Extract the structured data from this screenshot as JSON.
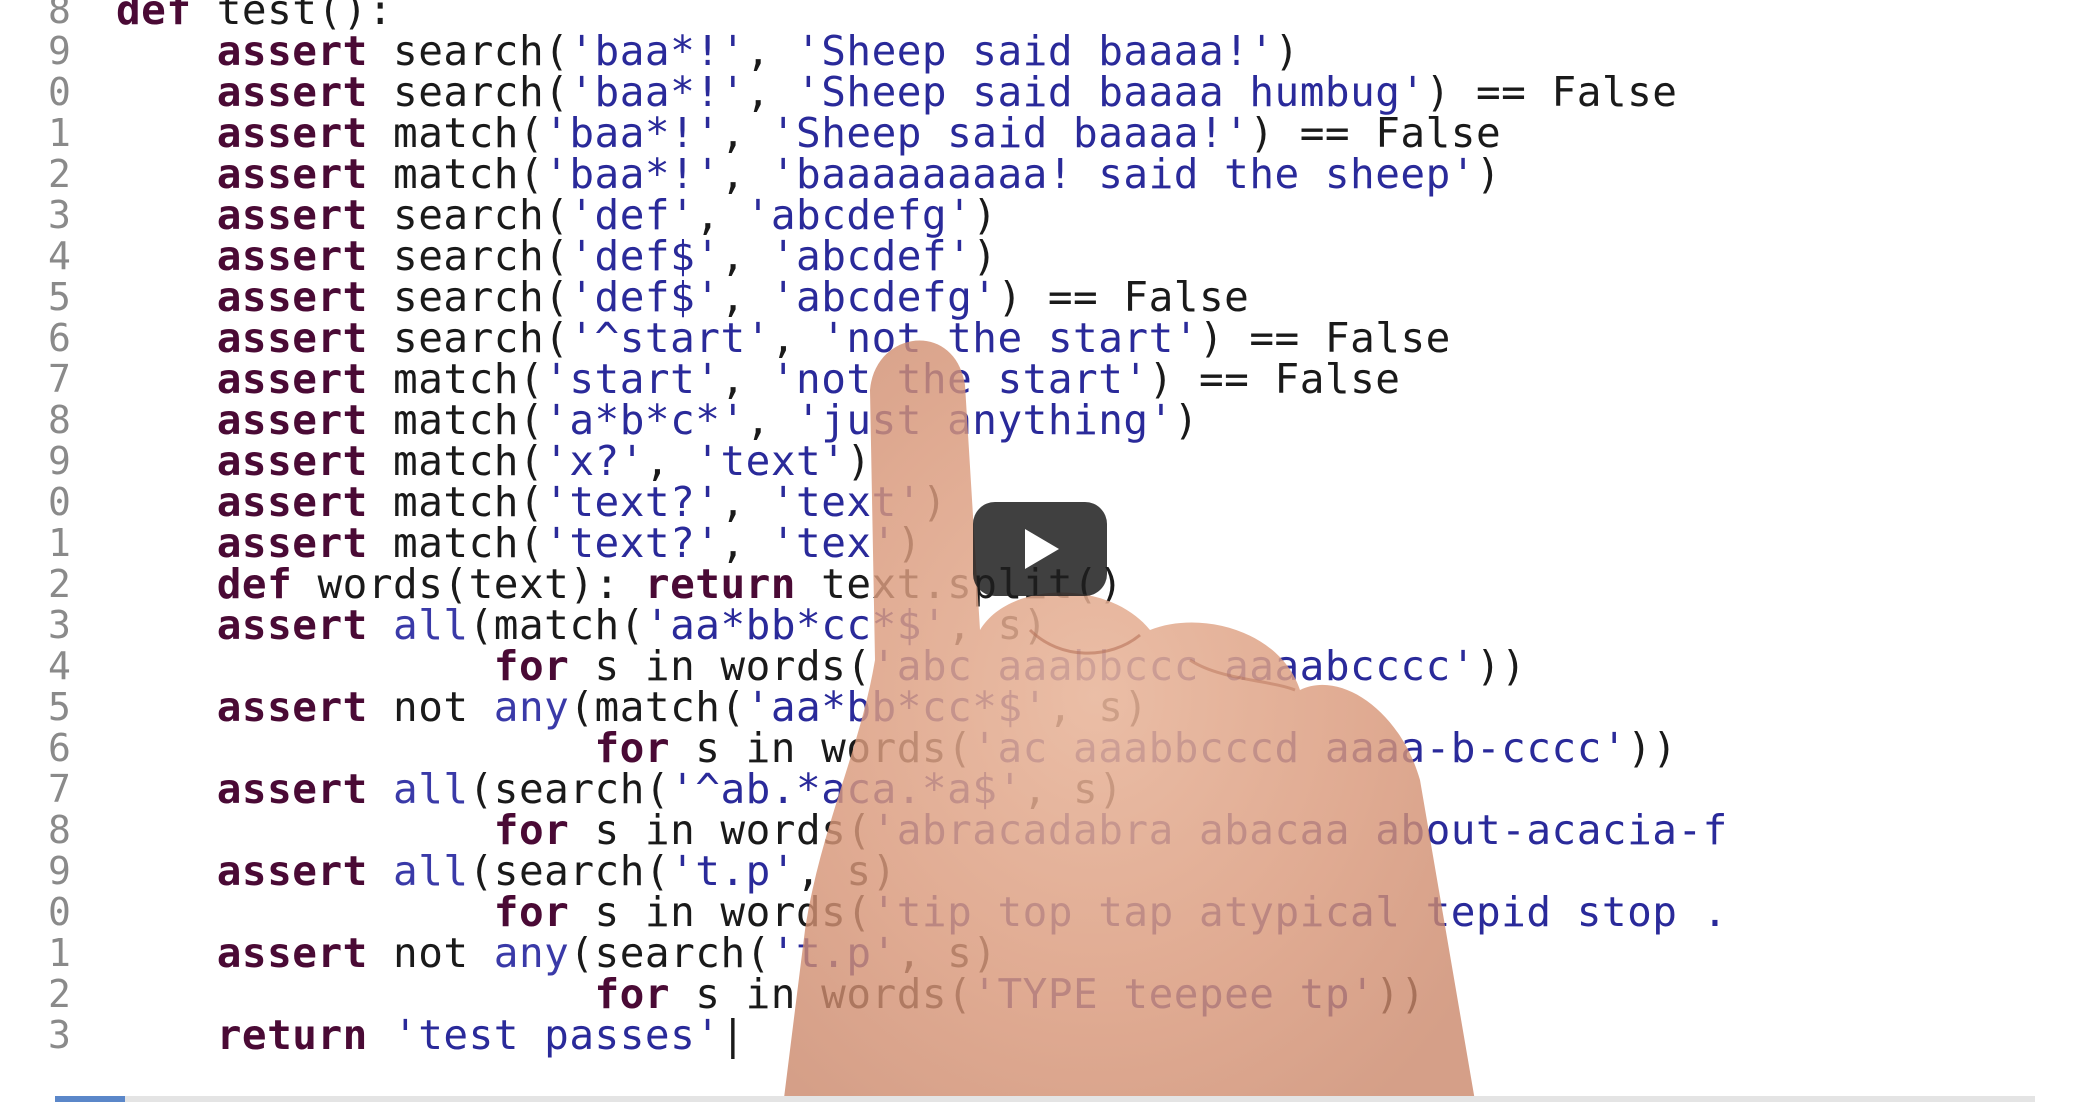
{
  "gutter_numbers": [
    "8",
    "9",
    "0",
    "1",
    "2",
    "3",
    "4",
    "5",
    "6",
    "7",
    "8",
    "9",
    "0",
    "1",
    "2",
    "3",
    "4",
    "5",
    "6",
    "7",
    "8",
    "9",
    "0",
    "1",
    "2",
    "3"
  ],
  "code_lines": [
    [
      {
        "t": "def",
        "c": "kw"
      },
      {
        "t": " test():",
        "c": "fn"
      }
    ],
    [
      {
        "t": "    ",
        "c": "fn"
      },
      {
        "t": "assert",
        "c": "kw"
      },
      {
        "t": " search(",
        "c": "fn"
      },
      {
        "t": "'baa*!'",
        "c": "str"
      },
      {
        "t": ", ",
        "c": "fn"
      },
      {
        "t": "'Sheep said baaaa!'",
        "c": "str"
      },
      {
        "t": ")",
        "c": "fn"
      }
    ],
    [
      {
        "t": "    ",
        "c": "fn"
      },
      {
        "t": "assert",
        "c": "kw"
      },
      {
        "t": " search(",
        "c": "fn"
      },
      {
        "t": "'baa*!'",
        "c": "str"
      },
      {
        "t": ", ",
        "c": "fn"
      },
      {
        "t": "'Sheep said baaaa humbug'",
        "c": "str"
      },
      {
        "t": ") == False",
        "c": "fn"
      }
    ],
    [
      {
        "t": "    ",
        "c": "fn"
      },
      {
        "t": "assert",
        "c": "kw"
      },
      {
        "t": " match(",
        "c": "fn"
      },
      {
        "t": "'baa*!'",
        "c": "str"
      },
      {
        "t": ", ",
        "c": "fn"
      },
      {
        "t": "'Sheep said baaaa!'",
        "c": "str"
      },
      {
        "t": ") == False",
        "c": "fn"
      }
    ],
    [
      {
        "t": "    ",
        "c": "fn"
      },
      {
        "t": "assert",
        "c": "kw"
      },
      {
        "t": " match(",
        "c": "fn"
      },
      {
        "t": "'baa*!'",
        "c": "str"
      },
      {
        "t": ", ",
        "c": "fn"
      },
      {
        "t": "'baaaaaaaaa! said the sheep'",
        "c": "str"
      },
      {
        "t": ")",
        "c": "fn"
      }
    ],
    [
      {
        "t": "    ",
        "c": "fn"
      },
      {
        "t": "assert",
        "c": "kw"
      },
      {
        "t": " search(",
        "c": "fn"
      },
      {
        "t": "'def'",
        "c": "str"
      },
      {
        "t": ", ",
        "c": "fn"
      },
      {
        "t": "'abcdefg'",
        "c": "str"
      },
      {
        "t": ")",
        "c": "fn"
      }
    ],
    [
      {
        "t": "    ",
        "c": "fn"
      },
      {
        "t": "assert",
        "c": "kw"
      },
      {
        "t": " search(",
        "c": "fn"
      },
      {
        "t": "'def$'",
        "c": "str"
      },
      {
        "t": ", ",
        "c": "fn"
      },
      {
        "t": "'abcdef'",
        "c": "str"
      },
      {
        "t": ")",
        "c": "fn"
      }
    ],
    [
      {
        "t": "    ",
        "c": "fn"
      },
      {
        "t": "assert",
        "c": "kw"
      },
      {
        "t": " search(",
        "c": "fn"
      },
      {
        "t": "'def$'",
        "c": "str"
      },
      {
        "t": ", ",
        "c": "fn"
      },
      {
        "t": "'abcdefg'",
        "c": "str"
      },
      {
        "t": ") == False",
        "c": "fn"
      }
    ],
    [
      {
        "t": "    ",
        "c": "fn"
      },
      {
        "t": "assert",
        "c": "kw"
      },
      {
        "t": " search(",
        "c": "fn"
      },
      {
        "t": "'^start'",
        "c": "str"
      },
      {
        "t": ", ",
        "c": "fn"
      },
      {
        "t": "'not the start'",
        "c": "str"
      },
      {
        "t": ") == False",
        "c": "fn"
      }
    ],
    [
      {
        "t": "    ",
        "c": "fn"
      },
      {
        "t": "assert",
        "c": "kw"
      },
      {
        "t": " match(",
        "c": "fn"
      },
      {
        "t": "'start'",
        "c": "str"
      },
      {
        "t": ", ",
        "c": "fn"
      },
      {
        "t": "'not the start'",
        "c": "str"
      },
      {
        "t": ") == False",
        "c": "fn"
      }
    ],
    [
      {
        "t": "    ",
        "c": "fn"
      },
      {
        "t": "assert",
        "c": "kw"
      },
      {
        "t": " match(",
        "c": "fn"
      },
      {
        "t": "'a*b*c*'",
        "c": "str"
      },
      {
        "t": ", ",
        "c": "fn"
      },
      {
        "t": "'just anything'",
        "c": "str"
      },
      {
        "t": ")",
        "c": "fn"
      }
    ],
    [
      {
        "t": "    ",
        "c": "fn"
      },
      {
        "t": "assert",
        "c": "kw"
      },
      {
        "t": " match(",
        "c": "fn"
      },
      {
        "t": "'x?'",
        "c": "str"
      },
      {
        "t": ", ",
        "c": "fn"
      },
      {
        "t": "'text'",
        "c": "str"
      },
      {
        "t": ")",
        "c": "fn"
      }
    ],
    [
      {
        "t": "    ",
        "c": "fn"
      },
      {
        "t": "assert",
        "c": "kw"
      },
      {
        "t": " match(",
        "c": "fn"
      },
      {
        "t": "'text?'",
        "c": "str"
      },
      {
        "t": ", ",
        "c": "fn"
      },
      {
        "t": "'text'",
        "c": "str"
      },
      {
        "t": ")",
        "c": "fn"
      }
    ],
    [
      {
        "t": "    ",
        "c": "fn"
      },
      {
        "t": "assert",
        "c": "kw"
      },
      {
        "t": " match(",
        "c": "fn"
      },
      {
        "t": "'text?'",
        "c": "str"
      },
      {
        "t": ", ",
        "c": "fn"
      },
      {
        "t": "'tex'",
        "c": "str"
      },
      {
        "t": ")",
        "c": "fn"
      }
    ],
    [
      {
        "t": "    ",
        "c": "fn"
      },
      {
        "t": "def",
        "c": "kw"
      },
      {
        "t": " words(text): ",
        "c": "fn"
      },
      {
        "t": "return",
        "c": "kw"
      },
      {
        "t": " text.split()",
        "c": "fn"
      }
    ],
    [
      {
        "t": "    ",
        "c": "fn"
      },
      {
        "t": "assert",
        "c": "kw"
      },
      {
        "t": " ",
        "c": "fn"
      },
      {
        "t": "all",
        "c": "bi"
      },
      {
        "t": "(match(",
        "c": "fn"
      },
      {
        "t": "'aa*bb*cc*$'",
        "c": "str"
      },
      {
        "t": ", s)",
        "c": "fn"
      }
    ],
    [
      {
        "t": "               ",
        "c": "fn"
      },
      {
        "t": "for",
        "c": "kw"
      },
      {
        "t": " s in words(",
        "c": "fn"
      },
      {
        "t": "'abc aaabbccc aaaabcccc'",
        "c": "str"
      },
      {
        "t": "))",
        "c": "fn"
      }
    ],
    [
      {
        "t": "    ",
        "c": "fn"
      },
      {
        "t": "assert",
        "c": "kw"
      },
      {
        "t": " not ",
        "c": "fn"
      },
      {
        "t": "any",
        "c": "bi"
      },
      {
        "t": "(match(",
        "c": "fn"
      },
      {
        "t": "'aa*bb*cc*$'",
        "c": "str"
      },
      {
        "t": ", s)",
        "c": "fn"
      }
    ],
    [
      {
        "t": "                   ",
        "c": "fn"
      },
      {
        "t": "for",
        "c": "kw"
      },
      {
        "t": " s in words(",
        "c": "fn"
      },
      {
        "t": "'ac aaabbcccd aaaa-b-cccc'",
        "c": "str"
      },
      {
        "t": "))",
        "c": "fn"
      }
    ],
    [
      {
        "t": "    ",
        "c": "fn"
      },
      {
        "t": "assert",
        "c": "kw"
      },
      {
        "t": " ",
        "c": "fn"
      },
      {
        "t": "all",
        "c": "bi"
      },
      {
        "t": "(search(",
        "c": "fn"
      },
      {
        "t": "'^ab.*aca.*a$'",
        "c": "str"
      },
      {
        "t": ", s)",
        "c": "fn"
      }
    ],
    [
      {
        "t": "               ",
        "c": "fn"
      },
      {
        "t": "for",
        "c": "kw"
      },
      {
        "t": " s in words(",
        "c": "fn"
      },
      {
        "t": "'abracadabra abacaa about-acacia-f",
        "c": "str"
      }
    ],
    [
      {
        "t": "    ",
        "c": "fn"
      },
      {
        "t": "assert",
        "c": "kw"
      },
      {
        "t": " ",
        "c": "fn"
      },
      {
        "t": "all",
        "c": "bi"
      },
      {
        "t": "(search(",
        "c": "fn"
      },
      {
        "t": "'t.p'",
        "c": "str"
      },
      {
        "t": ", s)",
        "c": "fn"
      }
    ],
    [
      {
        "t": "               ",
        "c": "fn"
      },
      {
        "t": "for",
        "c": "kw"
      },
      {
        "t": " s in words(",
        "c": "fn"
      },
      {
        "t": "'tip top tap atypical tepid stop .",
        "c": "str"
      }
    ],
    [
      {
        "t": "    ",
        "c": "fn"
      },
      {
        "t": "assert",
        "c": "kw"
      },
      {
        "t": " not ",
        "c": "fn"
      },
      {
        "t": "any",
        "c": "bi"
      },
      {
        "t": "(search(",
        "c": "fn"
      },
      {
        "t": "'t.p'",
        "c": "str"
      },
      {
        "t": ", s)",
        "c": "fn"
      }
    ],
    [
      {
        "t": "                   ",
        "c": "fn"
      },
      {
        "t": "for",
        "c": "kw"
      },
      {
        "t": " s in words(",
        "c": "fn"
      },
      {
        "t": "'TYPE teepee tp'",
        "c": "str"
      },
      {
        "t": "))",
        "c": "fn"
      }
    ],
    [
      {
        "t": "    ",
        "c": "fn"
      },
      {
        "t": "return",
        "c": "kw"
      },
      {
        "t": " ",
        "c": "fn"
      },
      {
        "t": "'test passes'",
        "c": "str"
      },
      {
        "t": "|",
        "c": "fn"
      }
    ]
  ],
  "colors": {
    "keyword": "#4a0a35",
    "string": "#2a2a9a",
    "builtin": "#3a3aa8",
    "gutter": "#8a8a8a",
    "progress": "#5b87c9"
  },
  "icons": {
    "play": "play-icon"
  }
}
